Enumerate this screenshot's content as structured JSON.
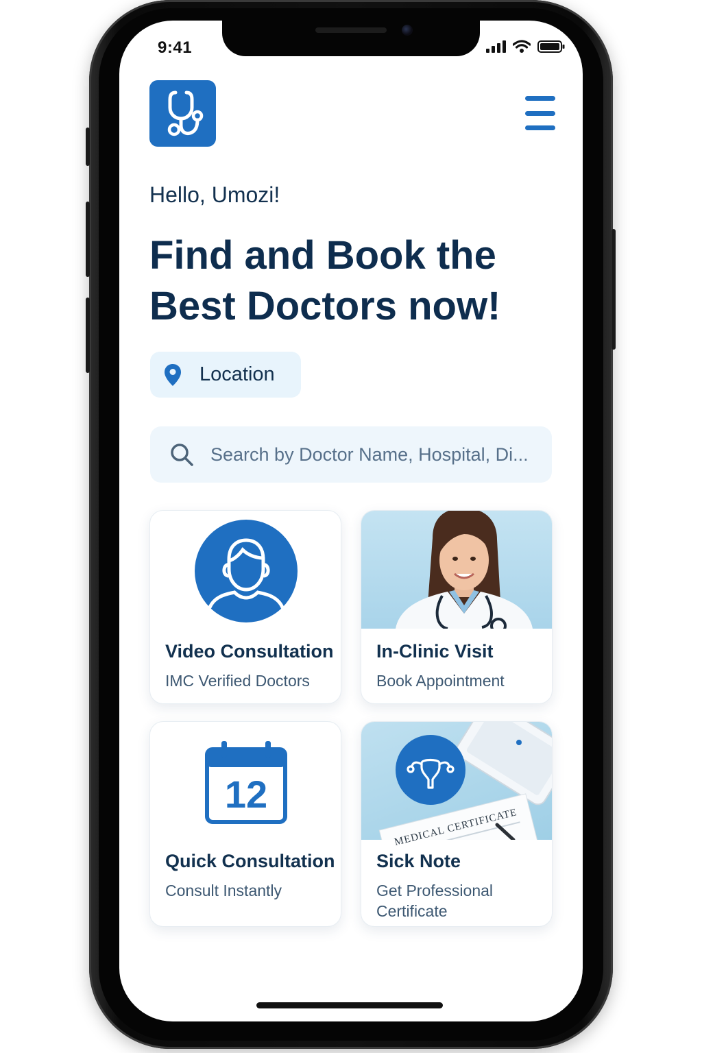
{
  "status_bar": {
    "time": "9:41"
  },
  "header": {
    "logo_icon": "stethoscope-icon",
    "menu_icon": "hamburger-menu-icon"
  },
  "greeting": "Hello, Umozi!",
  "headline": "Find and Book the Best Doctors now!",
  "location": {
    "icon": "location-pin-icon",
    "label": "Location"
  },
  "search": {
    "icon": "search-icon",
    "placeholder": "Search by Doctor Name, Hospital, Di..."
  },
  "cards": [
    {
      "title": "Video Consultation",
      "subtitle": "IMC Verified Doctors",
      "icon": "user-avatar-icon"
    },
    {
      "title": "In-Clinic Visit",
      "subtitle": "Book Appointment",
      "image": "doctor-photo"
    },
    {
      "title": "Quick Consultation",
      "subtitle": "Consult Instantly",
      "icon": "calendar-icon",
      "icon_text": "12"
    },
    {
      "title": "Sick Note",
      "subtitle": "Get Professional Certificate",
      "image": "medical-certificate-photo",
      "image_text": "MEDICAL CERTIFICATE"
    }
  ],
  "colors": {
    "brand_blue": "#1f6fc1",
    "heading_navy": "#0e2d4e",
    "chip_bg": "#e8f4fc"
  }
}
